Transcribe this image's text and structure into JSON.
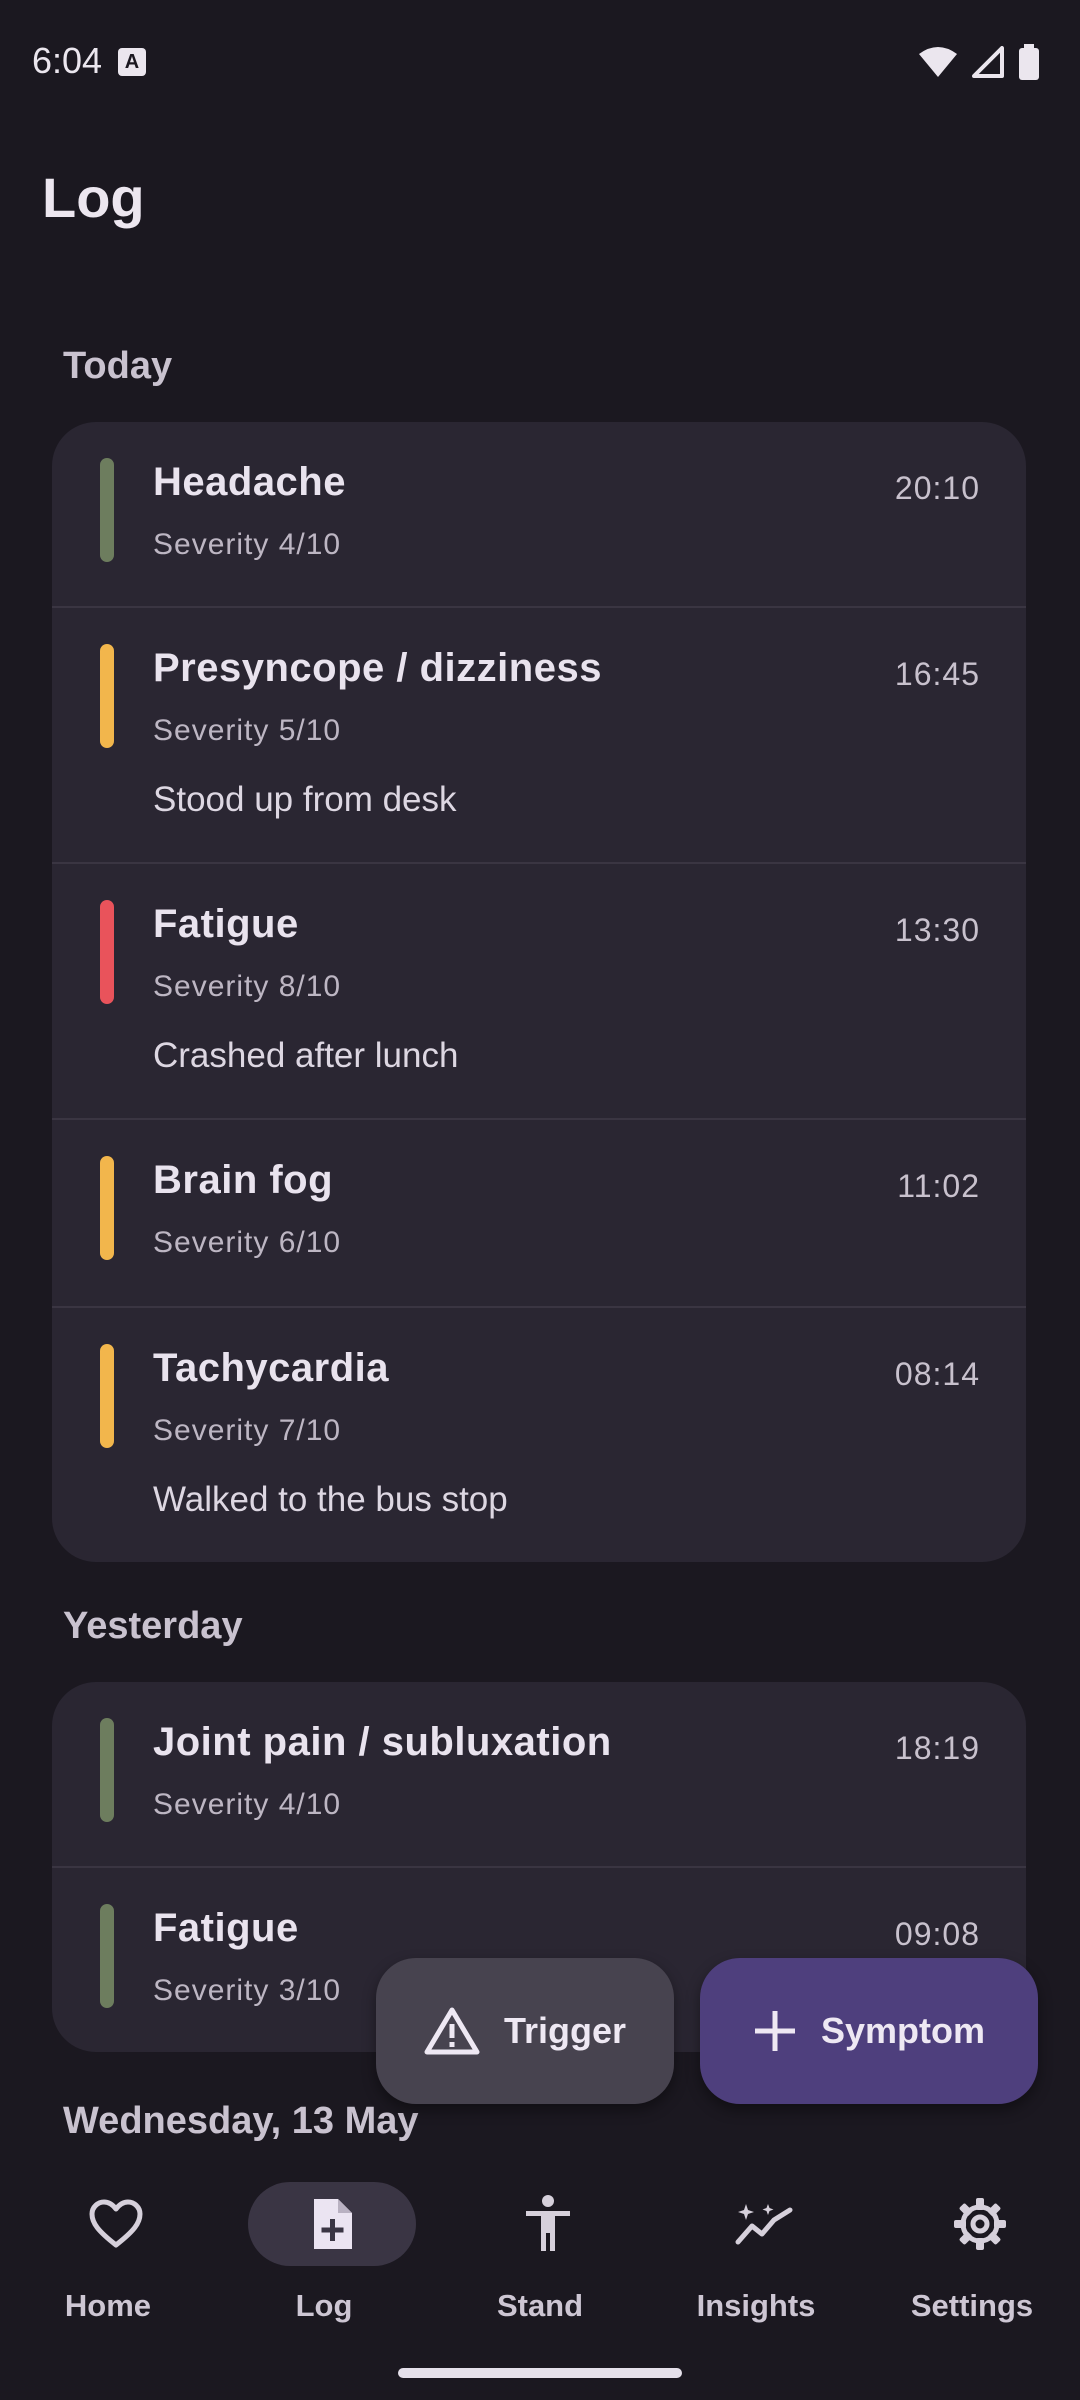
{
  "status": {
    "time": "6:04",
    "a_icon": "A"
  },
  "header": {
    "title": "Log"
  },
  "sections": [
    {
      "title": "Today",
      "entries": [
        {
          "name": "Headache",
          "time": "20:10",
          "severity": "Severity 4/10",
          "note": "",
          "color": "#6d7d5e"
        },
        {
          "name": "Presyncope / dizziness",
          "time": "16:45",
          "severity": "Severity 5/10",
          "note": "Stood up from desk",
          "color": "#f2b64c"
        },
        {
          "name": "Fatigue",
          "time": "13:30",
          "severity": "Severity 8/10",
          "note": "Crashed after lunch",
          "color": "#e9535b"
        },
        {
          "name": "Brain fog",
          "time": "11:02",
          "severity": "Severity 6/10",
          "note": "",
          "color": "#f2b64c"
        },
        {
          "name": "Tachycardia",
          "time": "08:14",
          "severity": "Severity 7/10",
          "note": "Walked to the bus stop",
          "color": "#f2b64c"
        }
      ]
    },
    {
      "title": "Yesterday",
      "entries": [
        {
          "name": "Joint pain / subluxation",
          "time": "18:19",
          "severity": "Severity 4/10",
          "note": "",
          "color": "#6d7d5e"
        },
        {
          "name": "Fatigue",
          "time": "09:08",
          "severity": "Severity 3/10",
          "note": "",
          "color": "#6d7d5e"
        }
      ]
    },
    {
      "title": "Wednesday, 13 May",
      "entries": []
    }
  ],
  "fabs": {
    "trigger_label": "Trigger",
    "symptom_label": "Symptom"
  },
  "nav": {
    "items": [
      {
        "label": "Home",
        "icon": "heart-icon"
      },
      {
        "label": "Log",
        "icon": "add-document-icon",
        "active": true
      },
      {
        "label": "Stand",
        "icon": "person-standing-icon"
      },
      {
        "label": "Insights",
        "icon": "trend-sparkle-icon"
      },
      {
        "label": "Settings",
        "icon": "gear-icon"
      }
    ]
  }
}
